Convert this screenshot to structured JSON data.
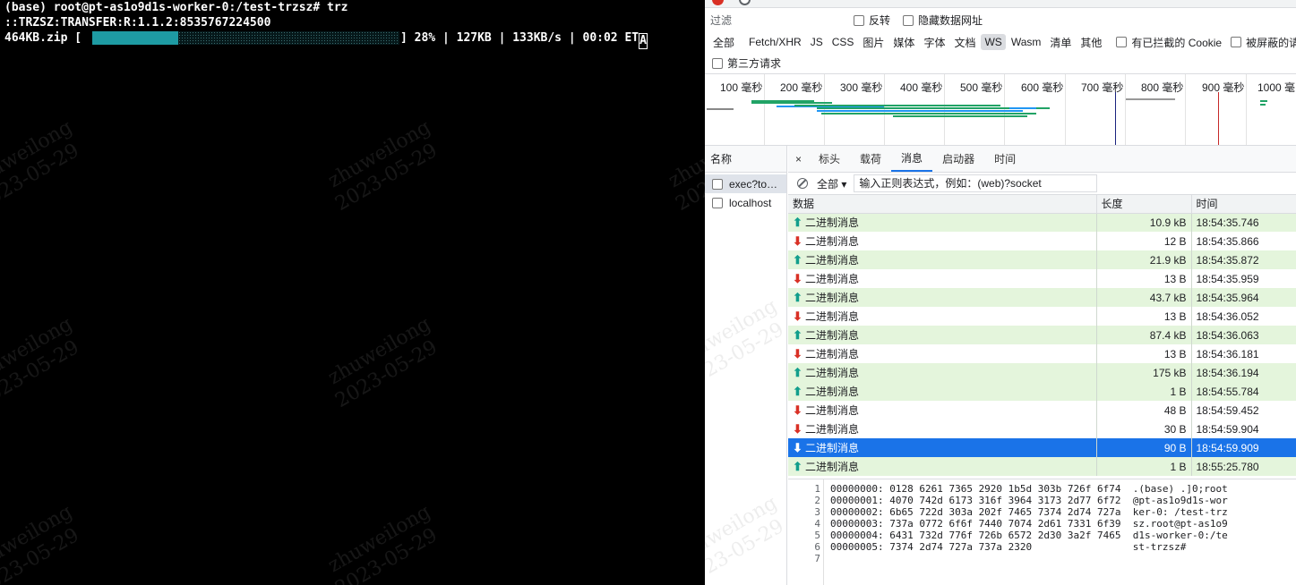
{
  "terminal": {
    "prompt_line": "(base) root@pt-as1o9d1s-worker-0:/test-trzsz# trz",
    "transfer_line": "::TRZSZ:TRANSFER:R:1.1.2:8535767224500",
    "file_name": "464KB.zip",
    "progress_percent": 28,
    "stats": "] 28% | 127KB | 133KB/s | 00:02 ET",
    "cursor_char": "A",
    "watermark_name": "zhuweilong",
    "watermark_date": "2023-05-29",
    "progress_color": "#1e9ba3"
  },
  "devtools": {
    "filter": {
      "placeholder": "过滤",
      "invert_label": "反转",
      "hide_data_urls_label": "隐藏数据网址"
    },
    "types": [
      "全部",
      "Fetch/XHR",
      "JS",
      "CSS",
      "图片",
      "媒体",
      "字体",
      "文档",
      "WS",
      "Wasm",
      "清单",
      "其他"
    ],
    "active_type": "WS",
    "blocked_cookies_label": "有已拦截的 Cookie",
    "blocked_requests_label": "被屏蔽的请",
    "third_party_label": "第三方请求",
    "timeline_ticks": [
      "100 毫秒",
      "200 毫秒",
      "300 毫秒",
      "400 毫秒",
      "500 毫秒",
      "600 毫秒",
      "700 毫秒",
      "800 毫秒",
      "900 毫秒",
      "1000 毫"
    ],
    "names_header": "名称",
    "requests": [
      {
        "name": "exec?to…",
        "selected": true
      },
      {
        "name": "localhost",
        "selected": false
      }
    ],
    "tabs": [
      "标头",
      "载荷",
      "消息",
      "启动器",
      "时间"
    ],
    "active_tab": "消息",
    "close_icon": "×",
    "msg_filter": {
      "mode": "全部",
      "placeholder": "输入正则表达式，例如：(web)?socket"
    },
    "columns": {
      "data": "数据",
      "length": "长度",
      "time": "时间"
    },
    "messages": [
      {
        "dir": "up",
        "label": "二进制消息",
        "length": "10.9 kB",
        "time": "18:54:35.746"
      },
      {
        "dir": "down",
        "label": "二进制消息",
        "length": "12 B",
        "time": "18:54:35.866"
      },
      {
        "dir": "up",
        "label": "二进制消息",
        "length": "21.9 kB",
        "time": "18:54:35.872"
      },
      {
        "dir": "down",
        "label": "二进制消息",
        "length": "13 B",
        "time": "18:54:35.959"
      },
      {
        "dir": "up",
        "label": "二进制消息",
        "length": "43.7 kB",
        "time": "18:54:35.964"
      },
      {
        "dir": "down",
        "label": "二进制消息",
        "length": "13 B",
        "time": "18:54:36.052"
      },
      {
        "dir": "up",
        "label": "二进制消息",
        "length": "87.4 kB",
        "time": "18:54:36.063"
      },
      {
        "dir": "down",
        "label": "二进制消息",
        "length": "13 B",
        "time": "18:54:36.181"
      },
      {
        "dir": "up",
        "label": "二进制消息",
        "length": "175 kB",
        "time": "18:54:36.194"
      },
      {
        "dir": "up",
        "label": "二进制消息",
        "length": "1 B",
        "time": "18:54:55.784"
      },
      {
        "dir": "down",
        "label": "二进制消息",
        "length": "48 B",
        "time": "18:54:59.452"
      },
      {
        "dir": "down",
        "label": "二进制消息",
        "length": "30 B",
        "time": "18:54:59.904"
      },
      {
        "dir": "down",
        "label": "二进制消息",
        "length": "90 B",
        "time": "18:54:59.909",
        "selected": true
      },
      {
        "dir": "up",
        "label": "二进制消息",
        "length": "1 B",
        "time": "18:55:25.780"
      }
    ],
    "hex_lines": [
      {
        "n": "1",
        "text": "00000000: 0128 6261 7365 2920 1b5d 303b 726f 6f74  .(base) .]0;root"
      },
      {
        "n": "2",
        "text": "00000001: 4070 742d 6173 316f 3964 3173 2d77 6f72  @pt-as1o9d1s-wor"
      },
      {
        "n": "3",
        "text": "00000002: 6b65 722d 303a 202f 7465 7374 2d74 727a  ker-0: /test-trz"
      },
      {
        "n": "4",
        "text": "00000003: 737a 0772 6f6f 7440 7074 2d61 7331 6f39  sz.root@pt-as1o9"
      },
      {
        "n": "5",
        "text": "00000004: 6431 732d 776f 726b 6572 2d30 3a2f 7465  d1s-worker-0:/te"
      },
      {
        "n": "6",
        "text": "00000005: 7374 2d74 727a 737a 2320                 st-trzsz#"
      },
      {
        "n": "7",
        "text": ""
      }
    ],
    "colors": {
      "sent_row": "#e4f5dc",
      "selected_row": "#1a73e8",
      "up_arrow": "#129e8c",
      "down_arrow": "#d93025"
    }
  }
}
